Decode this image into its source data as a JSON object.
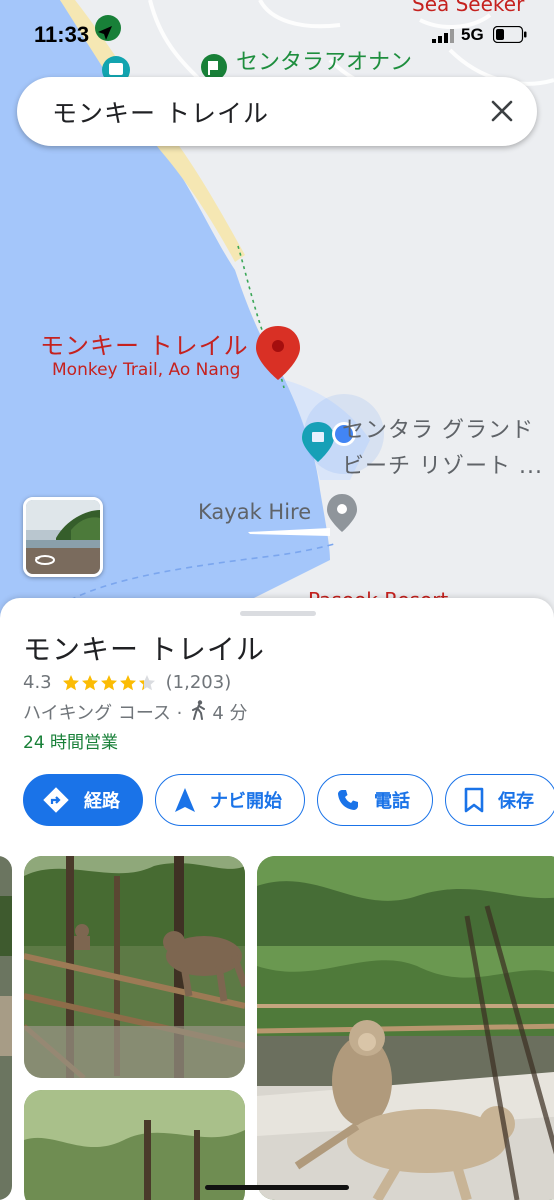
{
  "status_bar": {
    "time": "11:33",
    "network": "5G"
  },
  "search": {
    "query": "モンキー トレイル"
  },
  "map": {
    "labels": {
      "resort_top": "センタラアオナン",
      "sea_seeker": "Sea Seeker",
      "pin_name_jp": "モンキー トレイル",
      "pin_name_en": "Monkey Trail, Ao Nang",
      "centara_line1": "センタラ グランド",
      "centara_line2": "ビーチ リゾート ...",
      "kayak": "Kayak Hire",
      "pasook": "Pasook Resort"
    },
    "colors": {
      "water": "#a4c6fa",
      "land": "#eceef1",
      "beach": "#f5e7b3",
      "pin": "#d93025",
      "location_dot": "#4285f4"
    }
  },
  "place": {
    "title": "モンキー トレイル",
    "rating": "4.3",
    "rating_stars": 4.3,
    "review_count": "(1,203)",
    "category": "ハイキング コース ·",
    "walk_time": "4 分",
    "hours": "24 時間営業"
  },
  "actions": {
    "directions": "経路",
    "start": "ナビ開始",
    "call": "電話",
    "save": "保存"
  },
  "icons": [
    "navigation-arrow-icon",
    "signal-icon",
    "battery-icon",
    "close-icon",
    "place-pin-icon",
    "location-dot-icon",
    "star-icon",
    "walking-icon",
    "directions-icon",
    "navigate-icon",
    "phone-icon",
    "bookmark-icon",
    "rotate-360-icon"
  ]
}
